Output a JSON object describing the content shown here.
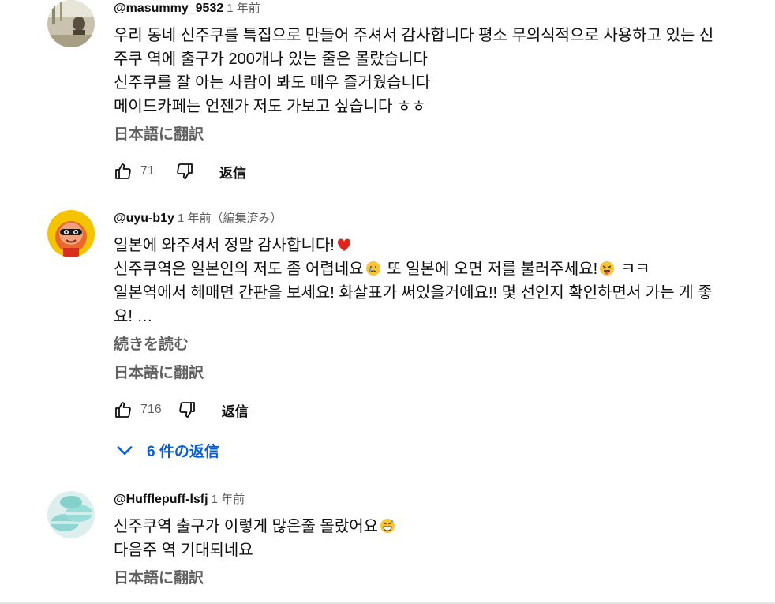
{
  "comments": [
    {
      "author": "@masummy_9532",
      "time": "1 年前",
      "lines": [
        "우리 동네 신주쿠를 특집으로 만들어 주셔서 감사합니다 평소 무의식적으로 사용하고 있는 신",
        "주쿠 역에 출구가 200개나 있는 줄은 몰랐습니다",
        "신주쿠를 잘 아는 사람이 봐도 매우 즐거웠습니다",
        "메이드카페는 언젠가 저도 가보고 싶습니다 ㅎㅎ"
      ],
      "translate_label": "日本語に翻訳",
      "like_count": "71",
      "reply_label": "返信"
    },
    {
      "author": "@uyu-b1y",
      "time": "1 年前（編集済み）",
      "line1": "일본에 와주셔서 정말 감사합니다!",
      "line2a": "신주쿠역은 일본인의 저도 좀 어렵네요",
      "line2b": " 또 일본에 오면 저를 불러주세요!",
      "line2c": " ㅋㅋ",
      "line3": "일본역에서 헤매면 간판을 보세요! 화살표가 써있을거에요!! 몇 선인지 확인하면서 가는 게 좋",
      "line4": "요! …",
      "read_more_label": "続きを読む",
      "translate_label": "日本語に翻訳",
      "like_count": "716",
      "reply_label": "返信",
      "replies_toggle": "6 件の返信"
    },
    {
      "author": "@Hufflepuff-lsfj",
      "time": "1 年前",
      "line1": "신주쿠역 출구가 이렇게 많은줄 몰랐어요",
      "line2": "다음주 역 기대되네요",
      "translate_label": "日本語に翻訳"
    }
  ],
  "colors": {
    "link_blue": "#065fd4",
    "secondary_text": "#606060",
    "primary_text": "#0f0f0f"
  },
  "icons": {
    "like": "thumbs-up-icon",
    "dislike": "thumbs-down-icon",
    "expand": "chevron-down-icon"
  }
}
